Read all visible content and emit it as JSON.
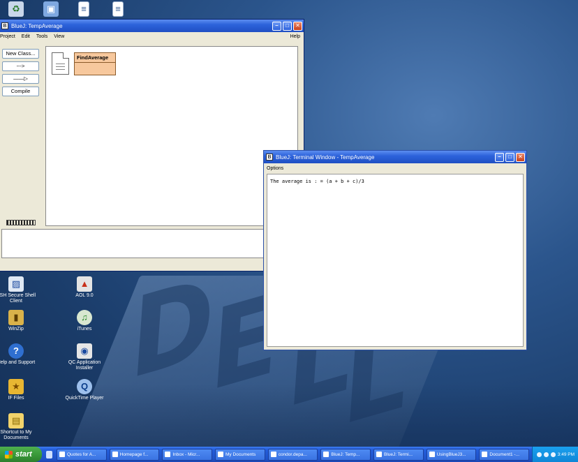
{
  "desktop": {
    "icons": [
      {
        "label": "",
        "icon": "recycle-bin-icon"
      },
      {
        "label": "",
        "icon": "network-icon"
      },
      {
        "label": "",
        "icon": "document-icon"
      },
      {
        "label": "",
        "icon": "document-icon"
      },
      {
        "label": "SSH Secure Shell Client",
        "icon": "ssh-icon"
      },
      {
        "label": "WinZip",
        "icon": "winzip-icon"
      },
      {
        "label": "Help and Support",
        "icon": "help-icon"
      },
      {
        "label": "IF Files",
        "icon": "star-icon"
      },
      {
        "label": "Shortcut to My Documents",
        "icon": "folder-icon"
      },
      {
        "label": "AOL 9.0",
        "icon": "aol-icon"
      },
      {
        "label": "iTunes",
        "icon": "itunes-icon"
      },
      {
        "label": "QC Application Installer",
        "icon": "installer-icon"
      },
      {
        "label": "QuickTime Player",
        "icon": "quicktime-icon"
      }
    ]
  },
  "bluej": {
    "title": "BlueJ: TempAverage",
    "menu": [
      "Project",
      "Edit",
      "Tools",
      "View"
    ],
    "help": "Help",
    "new_class": "New Class...",
    "arrow1": "--->",
    "arrow2": "——▷",
    "compile": "Compile",
    "class_name": "FindAverage"
  },
  "terminal": {
    "title": "BlueJ: Terminal Window - TempAverage",
    "menu_options": "Options",
    "output": "The average is :  = (a + b + c)/3"
  },
  "taskbar": {
    "start": "start",
    "tasks": [
      "Quotes for A...",
      "Homepage f...",
      "Inbox - Micr...",
      "My Documents",
      "condor.depa...",
      "BlueJ: Temp...",
      "BlueJ: Termi...",
      "UsingBlueJ3...",
      "Document1 -..."
    ],
    "clock": "3:49 PM"
  },
  "colors": {
    "titlebar": "#2d63db",
    "class_box": "#f7c89d",
    "desktop": "#2b558c",
    "taskbar": "#245edb",
    "start": "#3a9a3a"
  }
}
